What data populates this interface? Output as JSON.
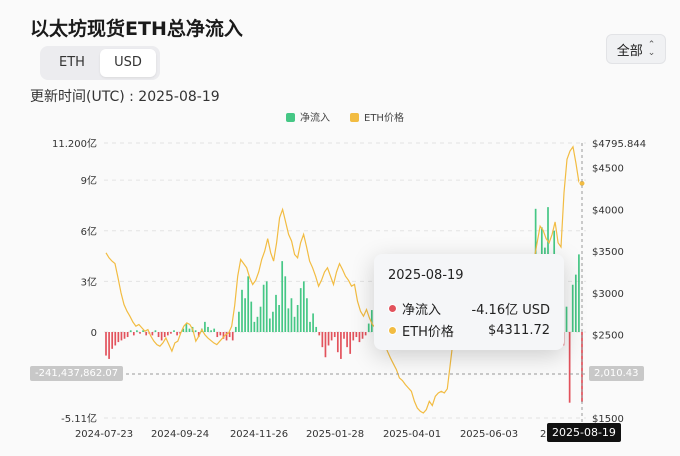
{
  "header": {
    "title": "以太坊现货ETH总净流入",
    "range_selector": "全部"
  },
  "toggle": {
    "eth_label": "ETH",
    "usd_label": "USD"
  },
  "updated": {
    "label": "更新时间(UTC) : ",
    "date": "2025-08-19"
  },
  "legend": [
    {
      "name": "净流入",
      "color": "#45c785"
    },
    {
      "name": "ETH价格",
      "color": "#f2bc42"
    }
  ],
  "tooltip": {
    "date": "2025-08-19",
    "rows": [
      {
        "label": "净流入",
        "value": "-4.16亿 USD",
        "color": "#e2525c"
      },
      {
        "label": "ETH价格",
        "value": "$4311.72",
        "color": "#f2bc42"
      }
    ]
  },
  "crosshair": {
    "left_value": "-241,437,862.07",
    "right_value": "2,010.43",
    "date": "2025-08-19"
  },
  "chart_data": {
    "type": "bar",
    "x_ticks": [
      "2024-07-23",
      "2024-09-24",
      "2024-11-26",
      "2025-01-28",
      "2025-04-01",
      "2025-06-03",
      "2025-08-19"
    ],
    "left_axis": {
      "ticks": [
        "11.200亿",
        "9亿",
        "6亿",
        "3亿",
        "0",
        "-5.11亿"
      ],
      "range": [
        -5.11,
        11.2
      ],
      "unit": "亿 USD"
    },
    "right_axis": {
      "ticks": [
        "$4795.844",
        "$4500",
        "$4000",
        "$3500",
        "$3000",
        "$2500",
        "$1500"
      ],
      "range": [
        1500,
        4795.844
      ],
      "unit": "USD"
    },
    "series": [
      {
        "name": "净流入",
        "kind": "bar",
        "pos_color": "#45c785",
        "neg_color": "#e2525c",
        "values": [
          -1.4,
          -1.6,
          -1.0,
          -0.8,
          -0.6,
          -0.5,
          -0.4,
          -0.3,
          0.1,
          -0.2,
          0.1,
          -0.1,
          0.1,
          -0.2,
          -0.1,
          -0.2,
          0.1,
          -0.3,
          -0.5,
          -0.3,
          -0.2,
          -0.1,
          0.1,
          -0.2,
          -0.1,
          0.2,
          0.5,
          0.2,
          0.3,
          0.1,
          -0.3,
          0.2,
          0.6,
          0.3,
          0.1,
          0.2,
          -0.3,
          -0.2,
          -0.4,
          -0.5,
          -0.3,
          -0.5,
          0.3,
          1.2,
          2.5,
          2.0,
          3.3,
          1.8,
          0.6,
          0.9,
          1.5,
          2.8,
          3.0,
          0.8,
          1.2,
          2.2,
          1.6,
          4.2,
          3.3,
          1.4,
          2.0,
          0.9,
          1.6,
          2.6,
          3.0,
          2.0,
          0.6,
          1.1,
          0.3,
          -0.2,
          -0.9,
          -1.5,
          -0.8,
          -0.5,
          -0.3,
          -1.2,
          -1.6,
          -0.4,
          -0.9,
          -1.3,
          -0.5,
          -0.3,
          -0.6,
          -0.4,
          -0.2,
          0.5,
          1.3,
          0.8,
          1.2,
          0.6,
          0.9,
          -0.2,
          -0.3,
          0.2,
          1.5,
          2.1,
          1.0,
          0.6,
          0.4,
          -0.3,
          0.7,
          0.9,
          0.4,
          0.2,
          -0.1,
          0.1,
          -0.2,
          -0.3,
          0.1,
          0.2,
          -0.1,
          0.1,
          0.2,
          0.1,
          -0.1,
          0.1,
          0.2,
          0.3,
          0.1,
          0.1,
          0.3,
          0.2,
          0.5,
          0.2,
          0.1,
          0.3,
          0.2,
          0.4,
          0.3,
          0.1,
          0.2,
          0.5,
          0.6,
          0.3,
          0.2,
          0.4,
          0.6,
          0.3,
          0.2,
          7.3,
          4.5,
          6.2,
          5.0,
          7.4,
          3.5,
          6.0,
          2.4,
          1.8,
          -0.8,
          1.5,
          -4.2,
          2.8,
          3.4,
          4.6,
          -4.16
        ]
      },
      {
        "name": "ETH价格",
        "kind": "line",
        "color": "#f2bc42",
        "values": [
          3480,
          3420,
          3380,
          3350,
          3180,
          3000,
          2860,
          2780,
          2720,
          2650,
          2600,
          2620,
          2580,
          2540,
          2560,
          2480,
          2420,
          2380,
          2360,
          2400,
          2460,
          2380,
          2300,
          2400,
          2420,
          2520,
          2600,
          2640,
          2620,
          2560,
          2420,
          2480,
          2560,
          2500,
          2460,
          2430,
          2400,
          2380,
          2420,
          2460,
          2500,
          2520,
          2600,
          2850,
          3200,
          3400,
          3350,
          3300,
          3180,
          3100,
          3150,
          3250,
          3400,
          3500,
          3650,
          3480,
          3380,
          3600,
          3900,
          4000,
          3850,
          3700,
          3620,
          3460,
          3420,
          3600,
          3700,
          3550,
          3380,
          3300,
          3200,
          3080,
          3150,
          3250,
          3300,
          3200,
          3100,
          3250,
          3350,
          3280,
          3200,
          3150,
          3080,
          3100,
          2900,
          2780,
          2720,
          2800,
          2700,
          2620,
          2580,
          2500,
          2450,
          2400,
          2300,
          2220,
          2150,
          2080,
          1980,
          1950,
          1900,
          1860,
          1820,
          1700,
          1620,
          1580,
          1560,
          1600,
          1700,
          1650,
          1760,
          1800,
          1820,
          1800,
          1850,
          2150,
          2450,
          2550,
          2520,
          2600,
          2560,
          2650,
          2700,
          2620,
          2550,
          2600,
          2580,
          2650,
          2560,
          2500,
          2480,
          2450,
          2520,
          2560,
          2480,
          2430,
          2500,
          2560,
          2600,
          2700,
          2900,
          3000,
          3150,
          3400,
          3600,
          3800,
          3750,
          3650,
          3600,
          3700,
          3850,
          3600,
          3550,
          4200,
          4600,
          4700,
          4750,
          4550,
          4320,
          4311.72
        ]
      }
    ],
    "grid": "dashed horizontal",
    "legend_position": "top-center"
  }
}
